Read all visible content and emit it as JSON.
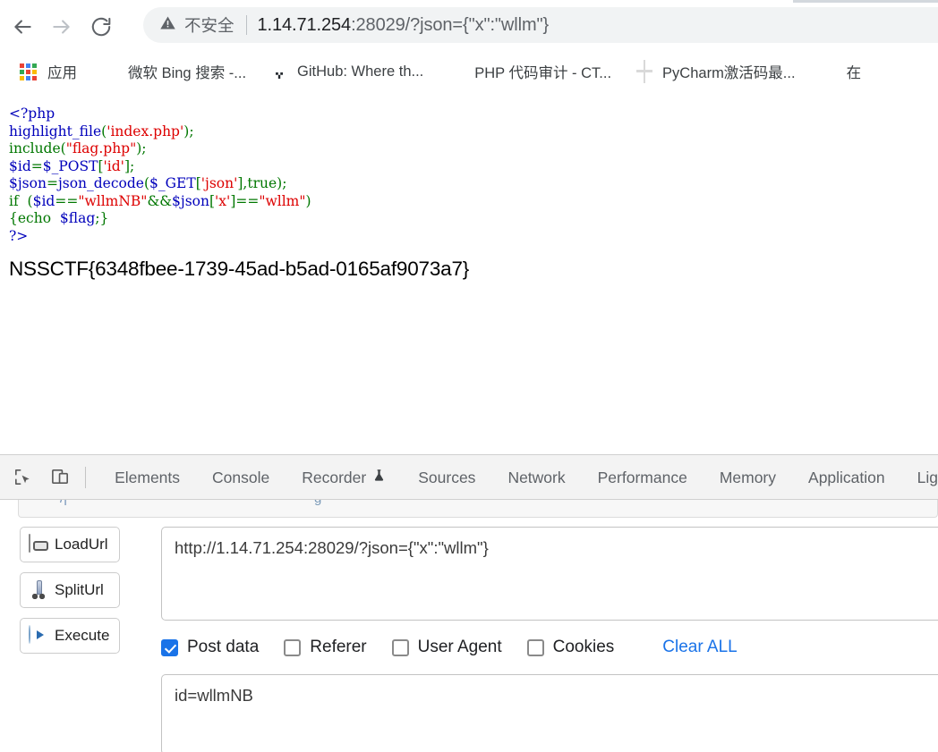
{
  "browser": {
    "nav": {
      "back_label": "Back",
      "forward_label": "Forward",
      "reload_label": "Reload"
    },
    "omnibox": {
      "security_icon": "warning-triangle-icon",
      "security_text": "不安全",
      "url_host": "1.14.71.254",
      "url_rest": ":28029/?json={\"x\":\"wllm\"}",
      "url_full": "1.14.71.254:28029/?json={\"x\":\"wllm\"}"
    },
    "bookmarks": [
      {
        "label": "应用",
        "icon": "apps-grid-icon"
      },
      {
        "label": "微软 Bing 搜索 -...",
        "icon": "baidu-paw-icon"
      },
      {
        "label": "GitHub: Where th...",
        "icon": "github-icon"
      },
      {
        "label": "PHP 代码审计 - CT...",
        "icon": "ctf-site-icon"
      },
      {
        "label": "PyCharm激活码最...",
        "icon": "globe-icon"
      },
      {
        "label": "在",
        "icon": "csdn-icon"
      }
    ]
  },
  "page": {
    "code_lines": [
      [
        {
          "t": "<?php",
          "c": "t-php"
        }
      ],
      [
        {
          "t": "highlight_file",
          "c": "t-fn"
        },
        {
          "t": "(",
          "c": "t-punct"
        },
        {
          "t": "'index.php'",
          "c": "t-str"
        },
        {
          "t": ")",
          "c": "t-punct"
        },
        {
          "t": ";",
          "c": "t-punct"
        }
      ],
      [
        {
          "t": "include",
          "c": "t-kw"
        },
        {
          "t": "(",
          "c": "t-punct"
        },
        {
          "t": "\"flag.php\"",
          "c": "t-str"
        },
        {
          "t": ")",
          "c": "t-punct"
        },
        {
          "t": ";",
          "c": "t-punct"
        }
      ],
      [
        {
          "t": "$id",
          "c": "t-var"
        },
        {
          "t": "=",
          "c": "t-kw"
        },
        {
          "t": "$_POST",
          "c": "t-var"
        },
        {
          "t": "[",
          "c": "t-punct"
        },
        {
          "t": "'id'",
          "c": "t-str"
        },
        {
          "t": "]",
          "c": "t-punct"
        },
        {
          "t": ";",
          "c": "t-punct"
        }
      ],
      [
        {
          "t": "$json",
          "c": "t-var"
        },
        {
          "t": "=",
          "c": "t-kw"
        },
        {
          "t": "json_decode",
          "c": "t-fn"
        },
        {
          "t": "(",
          "c": "t-punct"
        },
        {
          "t": "$_GET",
          "c": "t-var"
        },
        {
          "t": "[",
          "c": "t-punct"
        },
        {
          "t": "'json'",
          "c": "t-str"
        },
        {
          "t": "]",
          "c": "t-punct"
        },
        {
          "t": ",",
          "c": "t-punct"
        },
        {
          "t": "true",
          "c": "t-kw"
        },
        {
          "t": ")",
          "c": "t-punct"
        },
        {
          "t": ";",
          "c": "t-punct"
        }
      ],
      [
        {
          "t": "if",
          "c": "t-kw"
        },
        {
          "t": "  (",
          "c": "t-punct"
        },
        {
          "t": "$id",
          "c": "t-var"
        },
        {
          "t": "==",
          "c": "t-kw"
        },
        {
          "t": "\"wllmNB\"",
          "c": "t-str"
        },
        {
          "t": "&&",
          "c": "t-kw"
        },
        {
          "t": "$json",
          "c": "t-var"
        },
        {
          "t": "[",
          "c": "t-punct"
        },
        {
          "t": "'x'",
          "c": "t-str"
        },
        {
          "t": "]",
          "c": "t-punct"
        },
        {
          "t": "==",
          "c": "t-kw"
        },
        {
          "t": "\"wllm\"",
          "c": "t-str"
        },
        {
          "t": ")",
          "c": "t-punct"
        }
      ],
      [
        {
          "t": "{",
          "c": "t-punct"
        },
        {
          "t": "echo",
          "c": "t-kw"
        },
        {
          "t": "  ",
          "c": "t-def"
        },
        {
          "t": "$flag",
          "c": "t-var"
        },
        {
          "t": ";",
          "c": "t-punct"
        },
        {
          "t": "}",
          "c": "t-punct"
        }
      ],
      [
        {
          "t": "?>",
          "c": "t-php"
        }
      ]
    ],
    "flag": "NSSCTF{6348fbee-1739-45ad-b5ad-0165af9073a7}"
  },
  "devtools": {
    "inspect_icon": "inspect-element-icon",
    "device_icon": "device-toolbar-icon",
    "tabs": [
      {
        "label": "Elements",
        "badge": ""
      },
      {
        "label": "Console",
        "badge": ""
      },
      {
        "label": "Recorder",
        "badge": "flask-icon"
      },
      {
        "label": "Sources",
        "badge": ""
      },
      {
        "label": "Network",
        "badge": ""
      },
      {
        "label": "Performance",
        "badge": ""
      },
      {
        "label": "Memory",
        "badge": ""
      },
      {
        "label": "Application",
        "badge": ""
      },
      {
        "label": "Lig",
        "badge": ""
      }
    ]
  },
  "hackbar": {
    "buttons": [
      {
        "label": "LoadUrl",
        "icon": "load-url-icon"
      },
      {
        "label": "SplitUrl",
        "icon": "split-url-icon"
      },
      {
        "label": "Execute",
        "icon": "execute-icon"
      }
    ],
    "url_value": "http://1.14.71.254:28029/?json={\"x\":\"wllm\"}",
    "options": [
      {
        "label": "Post data",
        "checked": true
      },
      {
        "label": "Referer",
        "checked": false
      },
      {
        "label": "User Agent",
        "checked": false
      },
      {
        "label": "Cookies",
        "checked": false
      }
    ],
    "clear_label": "Clear ALL",
    "post_data_value": "id=wllmNB"
  },
  "colors": {
    "accent": "#1a73e8",
    "omnibox_bg": "#f1f3f4",
    "devtools_bg": "#f3f3f3",
    "php_string": "#dd0000",
    "php_keyword": "#007700",
    "php_var": "#0000bb"
  }
}
